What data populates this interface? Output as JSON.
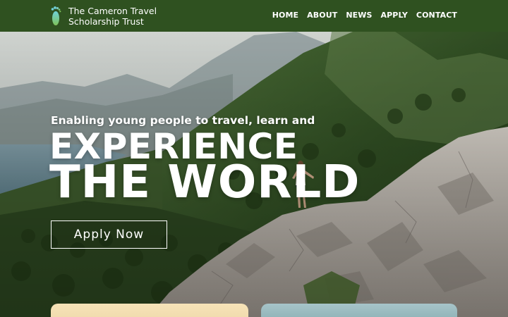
{
  "brand": {
    "line1": "The Cameron Travel",
    "line2": "Scholarship Trust",
    "logo_icon": "footprint-icon"
  },
  "nav": {
    "items": [
      {
        "label": "HOME"
      },
      {
        "label": "ABOUT"
      },
      {
        "label": "NEWS"
      },
      {
        "label": "APPLY"
      },
      {
        "label": "CONTACT"
      }
    ]
  },
  "hero": {
    "tagline": "Enabling young people to travel, learn and",
    "headline_line1": "EXPERIENCE",
    "headline_line2": "THE WORLD",
    "cta_label": "Apply Now"
  },
  "colors": {
    "header_bg": "#2f5120",
    "text": "#ffffff"
  }
}
